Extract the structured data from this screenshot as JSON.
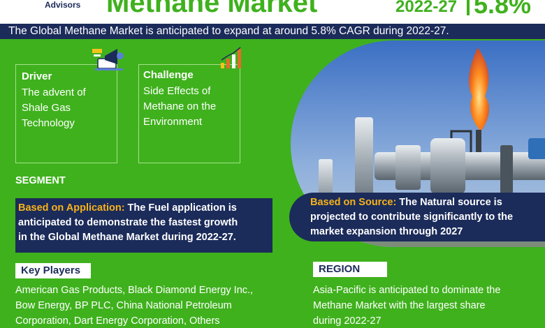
{
  "header": {
    "brand": "Advisors",
    "title": "Methane Market",
    "years": "2022-27",
    "cagr": "5.8%"
  },
  "banner": "The Global Methane Market is anticipated to expand at around 5.8% CAGR during 2022-27.",
  "driver": {
    "title": "Driver",
    "text_lines": [
      "The advent of",
      "Shale Gas",
      "Technology"
    ]
  },
  "challenge": {
    "title": "Challenge",
    "text_lines": [
      "Side Effects of",
      "Methane on the",
      "Environment"
    ]
  },
  "segment": {
    "label": "SEGMENT",
    "application": {
      "key": "Based on Application:",
      "lines": [
        " The Fuel application is",
        "anticipated to demonstrate the fastest growth",
        "in the Global Methane Market during 2022-27."
      ]
    },
    "source": {
      "key": "Based on Source:",
      "lines": [
        " The Natural source is",
        "projected to contribute significantly to the",
        "market expansion through 2027"
      ]
    }
  },
  "key_players": {
    "label": "Key Players",
    "lines": [
      "American Gas Products, Black Diamond Energy Inc.,",
      "Bow Energy, BP PLC, China National Petroleum",
      "Corporation, Dart Energy Corporation, Others"
    ]
  },
  "region": {
    "label": "REGION",
    "lines": [
      "Asia-Pacific is anticipated to dominate the",
      "Methane Market with the largest share",
      "during 2022-27"
    ]
  },
  "icons": {
    "driver": "megaphone-icon",
    "challenge": "bar-chart-icon"
  },
  "colors": {
    "green": "#3fb11d",
    "navy": "#1b2b5a",
    "highlight": "#f6b21b"
  }
}
